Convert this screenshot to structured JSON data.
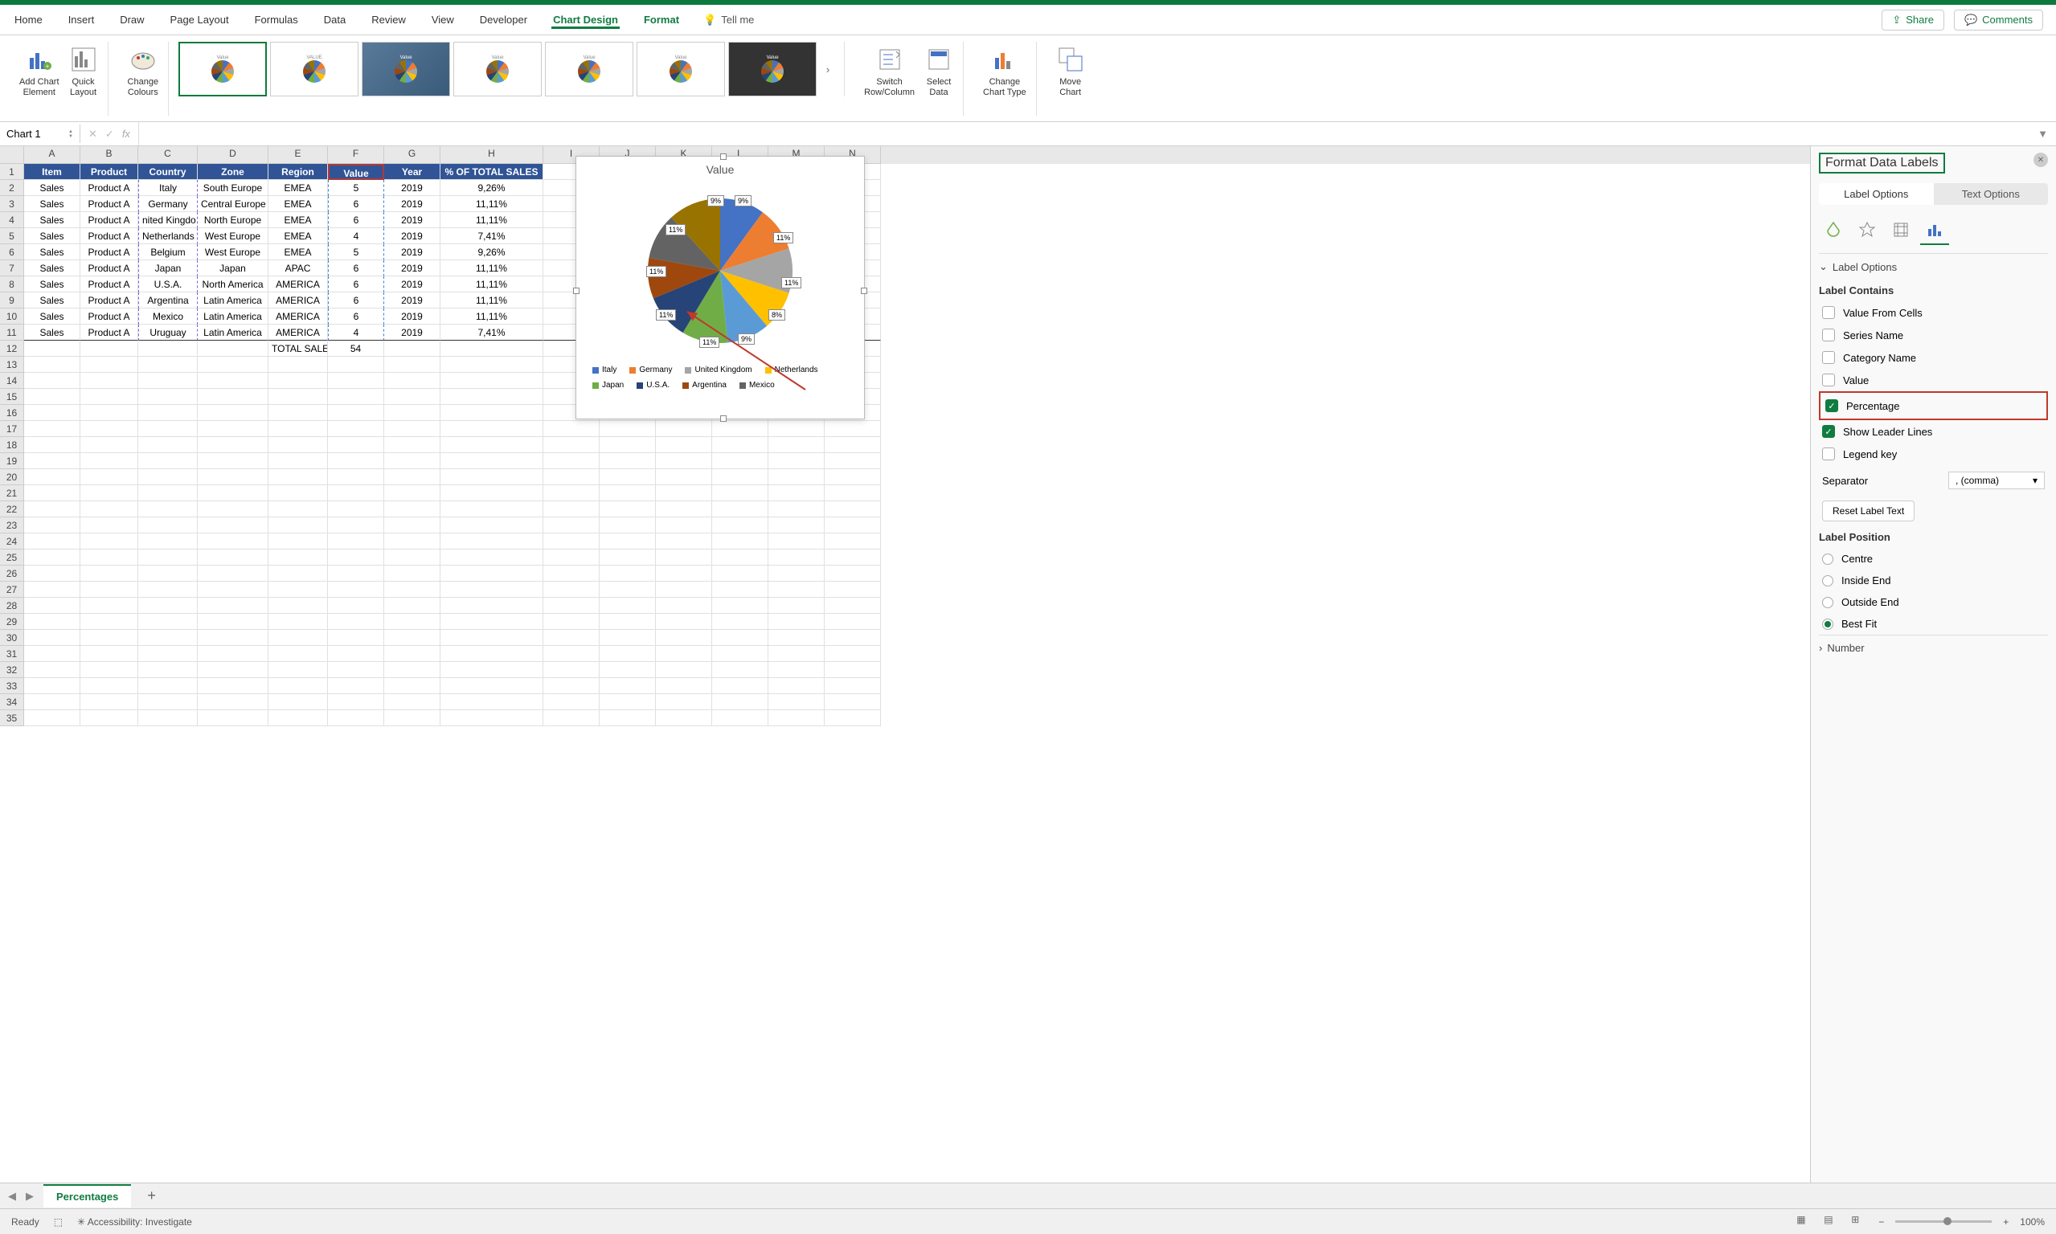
{
  "ribbon": {
    "tabs": [
      "Home",
      "Insert",
      "Draw",
      "Page Layout",
      "Formulas",
      "Data",
      "Review",
      "View",
      "Developer",
      "Chart Design",
      "Format"
    ],
    "active_tab": "Chart Design",
    "tell_me": "Tell me",
    "share": "Share",
    "comments": "Comments",
    "groups": {
      "add_chart_element": "Add Chart\nElement",
      "quick_layout": "Quick\nLayout",
      "change_colours": "Change\nColours",
      "switch_row_col": "Switch\nRow/Column",
      "select_data": "Select\nData",
      "change_chart_type": "Change\nChart Type",
      "move_chart": "Move\nChart"
    }
  },
  "name_box": "Chart 1",
  "columns": [
    "A",
    "B",
    "C",
    "D",
    "E",
    "F",
    "G",
    "H",
    "I",
    "J",
    "K",
    "L",
    "M",
    "N"
  ],
  "headers": {
    "item": "Item",
    "product": "Product",
    "country": "Country",
    "zone": "Zone",
    "region": "Region",
    "value": "Value",
    "year": "Year",
    "pct": "% OF TOTAL SALES"
  },
  "rows": [
    {
      "item": "Sales",
      "product": "Product A",
      "country": "Italy",
      "zone": "South Europe",
      "region": "EMEA",
      "value": "5",
      "year": "2019",
      "pct": "9,26%"
    },
    {
      "item": "Sales",
      "product": "Product A",
      "country": "Germany",
      "zone": "Central Europe",
      "region": "EMEA",
      "value": "6",
      "year": "2019",
      "pct": "11,11%"
    },
    {
      "item": "Sales",
      "product": "Product A",
      "country": "nited Kingdo",
      "zone": "North Europe",
      "region": "EMEA",
      "value": "6",
      "year": "2019",
      "pct": "11,11%"
    },
    {
      "item": "Sales",
      "product": "Product A",
      "country": "Netherlands",
      "zone": "West Europe",
      "region": "EMEA",
      "value": "4",
      "year": "2019",
      "pct": "7,41%"
    },
    {
      "item": "Sales",
      "product": "Product A",
      "country": "Belgium",
      "zone": "West Europe",
      "region": "EMEA",
      "value": "5",
      "year": "2019",
      "pct": "9,26%"
    },
    {
      "item": "Sales",
      "product": "Product A",
      "country": "Japan",
      "zone": "Japan",
      "region": "APAC",
      "value": "6",
      "year": "2019",
      "pct": "11,11%"
    },
    {
      "item": "Sales",
      "product": "Product A",
      "country": "U.S.A.",
      "zone": "North America",
      "region": "AMERICA",
      "value": "6",
      "year": "2019",
      "pct": "11,11%"
    },
    {
      "item": "Sales",
      "product": "Product A",
      "country": "Argentina",
      "zone": "Latin America",
      "region": "AMERICA",
      "value": "6",
      "year": "2019",
      "pct": "11,11%"
    },
    {
      "item": "Sales",
      "product": "Product A",
      "country": "Mexico",
      "zone": "Latin America",
      "region": "AMERICA",
      "value": "6",
      "year": "2019",
      "pct": "11,11%"
    },
    {
      "item": "Sales",
      "product": "Product A",
      "country": "Uruguay",
      "zone": "Latin America",
      "region": "AMERICA",
      "value": "4",
      "year": "2019",
      "pct": "7,41%"
    }
  ],
  "total_label": "TOTAL SALES",
  "total_value": "54",
  "chart": {
    "title": "Value",
    "labels": [
      "9%",
      "9%",
      "11%",
      "11%",
      "8%",
      "9%",
      "11%",
      "11%",
      "11%",
      "11%"
    ],
    "legend": [
      {
        "name": "Italy",
        "color": "#4472c4"
      },
      {
        "name": "Germany",
        "color": "#ed7d31"
      },
      {
        "name": "United Kingdom",
        "color": "#a5a5a5"
      },
      {
        "name": "Netherlands",
        "color": "#ffc000"
      },
      {
        "name": "Japan",
        "color": "#70ad47"
      },
      {
        "name": "U.S.A.",
        "color": "#264478"
      },
      {
        "name": "Argentina",
        "color": "#9e480e"
      },
      {
        "name": "Mexico",
        "color": "#636363"
      }
    ]
  },
  "chart_data": {
    "type": "pie",
    "title": "Value",
    "series": [
      {
        "name": "Value",
        "values": [
          5,
          6,
          6,
          4,
          5,
          6,
          6,
          6,
          6,
          4
        ]
      }
    ],
    "categories": [
      "Italy",
      "Germany",
      "United Kingdom",
      "Netherlands",
      "Belgium",
      "Japan",
      "U.S.A.",
      "Argentina",
      "Mexico",
      "Uruguay"
    ],
    "data_labels": "percentage",
    "legend_position": "bottom"
  },
  "format_panel": {
    "title": "Format Data Labels",
    "tabs": {
      "label_options": "Label Options",
      "text_options": "Text Options"
    },
    "section_label_options": "Label Options",
    "label_contains": "Label Contains",
    "opts": {
      "value_from_cells": "Value From Cells",
      "series_name": "Series Name",
      "category_name": "Category Name",
      "value": "Value",
      "percentage": "Percentage",
      "show_leader_lines": "Show Leader Lines",
      "legend_key": "Legend key"
    },
    "separator_label": "Separator",
    "separator_value": ", (comma)",
    "reset": "Reset Label Text",
    "label_position": "Label Position",
    "positions": {
      "centre": "Centre",
      "inside_end": "Inside End",
      "outside_end": "Outside End",
      "best_fit": "Best Fit"
    },
    "number_section": "Number"
  },
  "sheet_tab": "Percentages",
  "status": {
    "ready": "Ready",
    "accessibility": "Accessibility: Investigate",
    "zoom": "100%"
  }
}
